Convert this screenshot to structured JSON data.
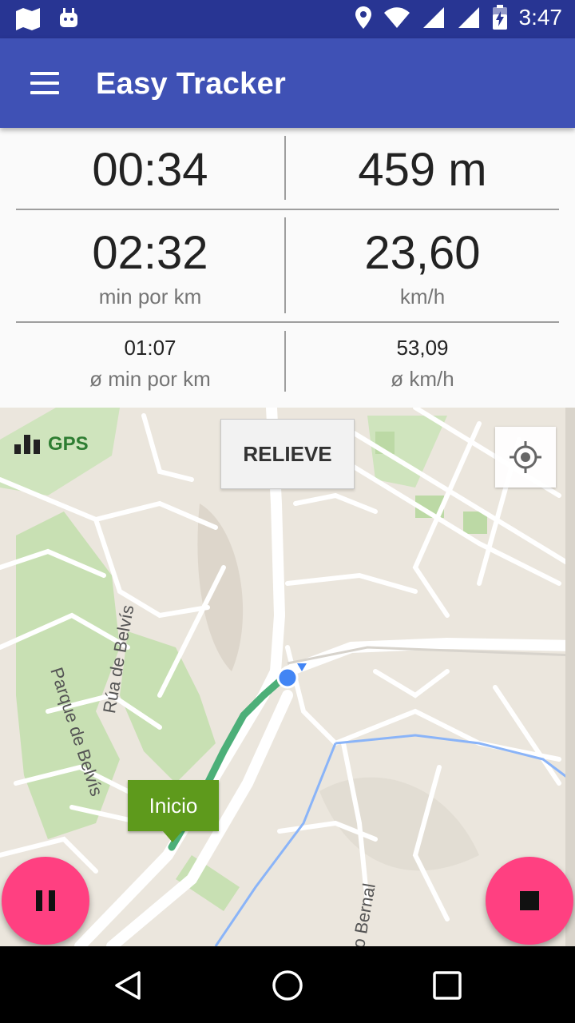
{
  "status_bar": {
    "time": "3:47"
  },
  "app_bar": {
    "title": "Easy Tracker"
  },
  "stats": {
    "elapsed_time": "00:34",
    "distance": "459 m",
    "pace": "02:32",
    "pace_unit": "min por km",
    "speed": "23,60",
    "speed_unit": "km/h",
    "avg_pace": "01:07",
    "avg_pace_unit": "ø min por km",
    "avg_speed": "53,09",
    "avg_speed_unit": "ø km/h"
  },
  "map": {
    "gps_label": "GPS",
    "relieve_button": "RELIEVE",
    "start_marker": "Inicio",
    "streets": {
      "rua_belvis": "Rúa de Belvís",
      "parque_belvis": "Parque de Belvís",
      "bernal": "o Bernal"
    }
  },
  "colors": {
    "status_bar": "#283593",
    "app_bar": "#3f51b5",
    "fab": "#ff4081",
    "track": "#4caf78",
    "start_marker": "#5e9a1c"
  },
  "icons": {
    "menu": "menu-icon",
    "locate": "my-location-icon",
    "pause": "pause-icon",
    "stop": "stop-icon",
    "back": "back-icon",
    "home": "home-icon",
    "recents": "recents-icon"
  }
}
